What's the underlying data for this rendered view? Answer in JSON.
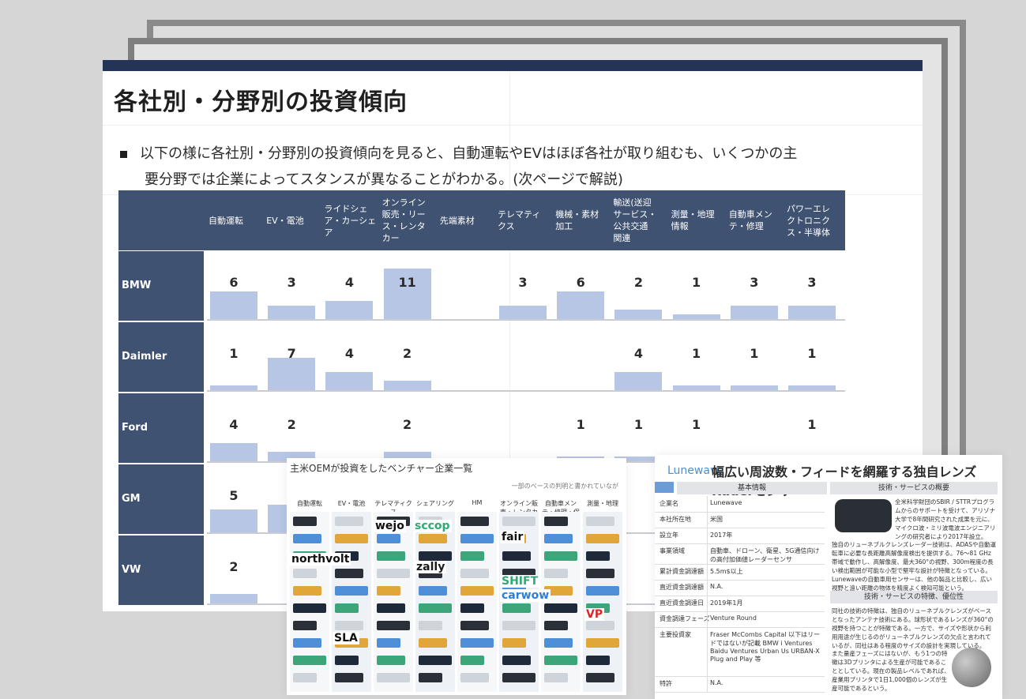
{
  "slide": {
    "title": "各社別・分野別の投資傾向",
    "bullet_line1": "以下の様に各社別・分野別の投資傾向を見ると、自動運転やEVはほぼ各社が取り組むも、いくつかの主",
    "bullet_line2": "要分野では企業によってスタンスが異なることがわかる。(次ページで解説)"
  },
  "chart_data": {
    "type": "bar",
    "categories": [
      "自動運転",
      "EV・電池",
      "ライドシェア・カーシェア",
      "オンライン販売・リース・レンタカー",
      "先端素材",
      "テレマティクス",
      "機械・素材加工",
      "輸送(送迎サービス・公共交通関連",
      "測量・地理情報",
      "自動車メンテ・修理",
      "パワーエレクトロニクス・半導体"
    ],
    "header_lines": [
      [
        "自動運転"
      ],
      [
        "EV・電池"
      ],
      [
        "ライドシェ",
        "ア・カーシェ",
        "ア"
      ],
      [
        "オンライン",
        "販売・リー",
        "ス・レンタ",
        "カー"
      ],
      [
        "先端素材"
      ],
      [
        "テレマティ",
        "クス"
      ],
      [
        "機械・素材",
        "加工"
      ],
      [
        "輸送(送迎",
        "サービス・",
        "公共交通",
        "関連"
      ],
      [
        "測量・地理",
        "情報"
      ],
      [
        "自動車メン",
        "テ・修理"
      ],
      [
        "パワーエレ",
        "クトロニク",
        "ス・半導体"
      ]
    ],
    "series": [
      {
        "name": "BMW",
        "values": [
          6,
          3,
          4,
          11,
          null,
          3,
          6,
          2,
          1,
          3,
          3
        ]
      },
      {
        "name": "Daimler",
        "values": [
          1,
          7,
          4,
          2,
          null,
          null,
          null,
          4,
          1,
          1,
          1
        ]
      },
      {
        "name": "Ford",
        "values": [
          4,
          2,
          null,
          2,
          null,
          null,
          1,
          1,
          1,
          null,
          1
        ]
      },
      {
        "name": "GM",
        "values": [
          5,
          6,
          null,
          null,
          null,
          null,
          null,
          null,
          null,
          null,
          null
        ]
      },
      {
        "name": "VW",
        "values": [
          2,
          null,
          null,
          null,
          null,
          null,
          null,
          null,
          null,
          null,
          null
        ]
      }
    ],
    "bar_color": "#b8c6e6",
    "header_color": "#3f5271"
  },
  "overlay_left": {
    "title": "主米OEMが投資をしたベンチャー企業一覧",
    "note": "一部のベースの判明と書かれていなが",
    "columns": [
      "自動運転",
      "EV・電池",
      "テレマティクス",
      "シェアリング",
      "HM",
      "オンライン販売・レンタカー",
      "自動車メンテ・修理・保守",
      "測量・地理"
    ],
    "logos": [
      "wejo",
      "sccop",
      "fair",
      "zally",
      "carwow",
      "northvolt",
      "SLA",
      "VP",
      "SHIFT"
    ]
  },
  "overlay_right": {
    "brand": "Lunewave",
    "headline": "幅広い周波数・フィードを網羅する独自レンズRaderセンサ",
    "basic_info_header": "基本情報",
    "tech_header": "技術・サービスの概要",
    "tech_features_header": "技術・サービスの特徴、優位性",
    "rows": [
      {
        "k": "企業名",
        "v": "Lunewave"
      },
      {
        "k": "本社所在地",
        "v": "米国"
      },
      {
        "k": "設立年",
        "v": "2017年"
      },
      {
        "k": "事業領域",
        "v": "自動車、ドローン、衛星、5G通信向けの高付加価値レーダーセンサ"
      },
      {
        "k": "累計資金調達額",
        "v": "5.5m$以上"
      },
      {
        "k": "直近資金調達額",
        "v": "N.A."
      },
      {
        "k": "直近資金調達日",
        "v": "2019年1月"
      },
      {
        "k": "資金調達フェーズ",
        "v": "Venture Round"
      },
      {
        "k": "主要投資家",
        "v": "Fraser McCombs Capital 以下はリードではないが記載 BMW i Ventures Baidu Ventures Urban Us URBAN-X Plug and Play 等"
      },
      {
        "k": "特許",
        "v": "N.A."
      }
    ],
    "tech_text": "全米科学財団のSBIR / STTRプログラムからのサポートを受けて、アリゾナ大学で8年間研究された成果を元に、マイクロ波・ミリ波電波エンジニアリングの研究者により2017年設立。",
    "tech_text2": "独自のリューネブルクレンズレーダー技術は、ADASや自動運転車に必要な長距離高解像度検出を提供する。76〜81 GHz帯域で動作し、高解像度、最大360°の視野、300m程度の長い検出範囲が可能な小型で堅牢な設計が特徴となっている。Lunewaveの自動車用センサーは、他の製品と比較し、広い視野と遠い距離の物体を精度よく検知可能という。",
    "feat_text": "同社の技術の特徴は、独自のリューネブルクレンズがベースとなったアンテナ技術にある。球形状であるレンズが360°の視野を持つことが特徴である。一方で、サイズや形状から利用用途が生じるのがリューネブルクレンズの欠点と言われているが、同社はある程度のサイズの設計を実現している。",
    "feat_text2": "また量産フェーズにはないが、もう1つの特徴は3Dプリンタによる生産が可能であることとしている。現在の製品レベルであれば、産業用プリンタで1日1,000個のレンズが生産可能であるという。"
  }
}
